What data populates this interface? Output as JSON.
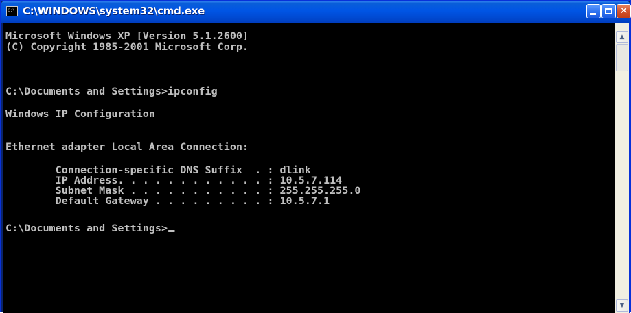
{
  "window": {
    "title": "C:\\WINDOWS\\system32\\cmd.exe",
    "icon": "console-icon"
  },
  "title_buttons": {
    "minimize": "minimize-icon",
    "maximize": "maximize-icon",
    "close": "✕"
  },
  "console": {
    "lines": [
      "Microsoft Windows XP [Version 5.1.2600]",
      "(C) Copyright 1985-2001 Microsoft Corp.",
      "C:\\Documents and Settings>ipconfig",
      "Windows IP Configuration",
      "Ethernet adapter Local Area Connection:",
      "        Connection-specific DNS Suffix  . : dlink",
      "        IP Address. . . . . . . . . . . . : 10.5.7.114",
      "        Subnet Mask . . . . . . . . . . . : 255.255.255.0",
      "        Default Gateway . . . . . . . . . : 10.5.7.1",
      "C:\\Documents and Settings>"
    ],
    "text_color": "#c0c0c0",
    "background": "#000000"
  },
  "scrollbar": {
    "up_glyph": "▲",
    "down_glyph": "▼"
  }
}
